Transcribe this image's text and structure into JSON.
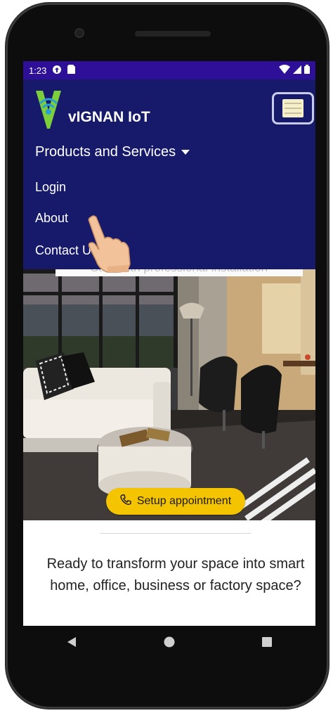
{
  "status_bar": {
    "time": "1:23",
    "icons": [
      "sync-icon",
      "sim-card-icon",
      "wifi-icon",
      "signal-icon",
      "battery-icon"
    ]
  },
  "brand": {
    "name": "vIGNAN IoT",
    "logo": "vignan-logo-icon"
  },
  "nav": {
    "items": [
      {
        "label": "Products and Services",
        "dropdown": true
      },
      {
        "label": "Login"
      },
      {
        "label": "About"
      },
      {
        "label": "Contact Us"
      }
    ],
    "toggler": "hamburger-menu-icon"
  },
  "hero": {
    "caption": "Start with professional installation",
    "cta_label": "Setup appointment",
    "cta_icon": "phone-icon"
  },
  "content": {
    "ready_text": "Ready to transform your space into smart home, office, business or factory space?"
  },
  "system_nav": {
    "icons": [
      "back-icon",
      "home-icon",
      "recents-icon"
    ]
  },
  "colors": {
    "status_bar": "#2e0f97",
    "navbar": "#171a6b",
    "cta": "#f5c400",
    "text_white": "#ffffff"
  }
}
